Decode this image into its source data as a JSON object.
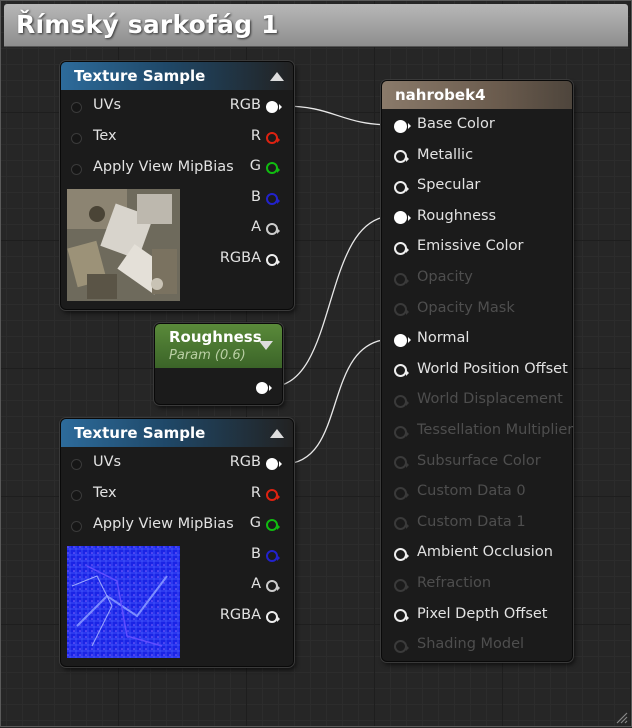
{
  "window": {
    "title": "Římský sarkofág 1"
  },
  "texture_sample_1": {
    "title": "Texture Sample",
    "inputs": [
      "UVs",
      "Tex",
      "Apply View MipBias"
    ],
    "outputs": [
      "RGB",
      "R",
      "G",
      "B",
      "A",
      "RGBA"
    ],
    "preview": "stone-sarcophagus-texture"
  },
  "roughness_param": {
    "title": "Roughness",
    "subtitle": "Param (0.6)"
  },
  "texture_sample_2": {
    "title": "Texture Sample",
    "inputs": [
      "UVs",
      "Tex",
      "Apply View MipBias"
    ],
    "outputs": [
      "RGB",
      "R",
      "G",
      "B",
      "A",
      "RGBA"
    ],
    "preview": "normal-map-texture"
  },
  "material_node": {
    "title": "nahrobek4",
    "inputs": [
      {
        "label": "Base Color",
        "active": true
      },
      {
        "label": "Metallic",
        "active": true
      },
      {
        "label": "Specular",
        "active": true
      },
      {
        "label": "Roughness",
        "active": true
      },
      {
        "label": "Emissive Color",
        "active": true
      },
      {
        "label": "Opacity",
        "active": false
      },
      {
        "label": "Opacity Mask",
        "active": false
      },
      {
        "label": "Normal",
        "active": true
      },
      {
        "label": "World Position Offset",
        "active": true
      },
      {
        "label": "World Displacement",
        "active": false
      },
      {
        "label": "Tessellation Multiplier",
        "active": false
      },
      {
        "label": "Subsurface Color",
        "active": false
      },
      {
        "label": "Custom Data 0",
        "active": false
      },
      {
        "label": "Custom Data 1",
        "active": false
      },
      {
        "label": "Ambient Occlusion",
        "active": true
      },
      {
        "label": "Refraction",
        "active": false
      },
      {
        "label": "Pixel Depth Offset",
        "active": true
      },
      {
        "label": "Shading Model",
        "active": false
      }
    ]
  },
  "colors": {
    "texture_header": "#2d6b9b",
    "param_header": "#5a8a3a",
    "result_header": "#8a7a6a",
    "wire": "#e8e8e8"
  }
}
